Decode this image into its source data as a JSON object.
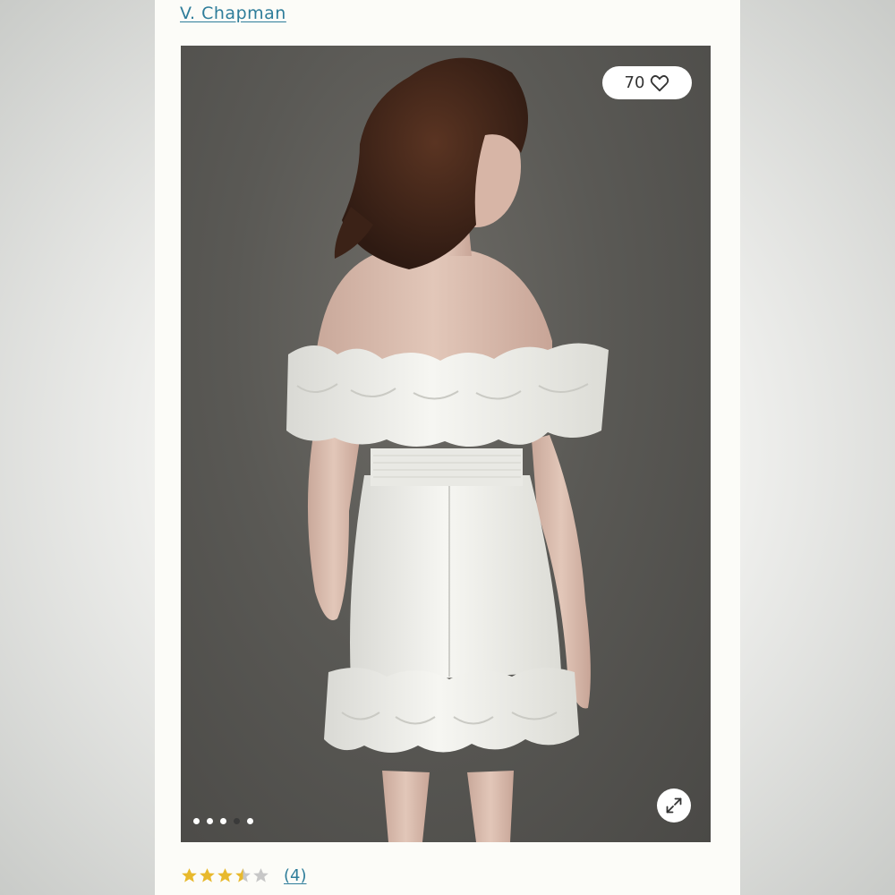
{
  "product": {
    "brand": "V. Chapman",
    "favorites_count": "70",
    "image_alt": "White off-the-shoulder ruffled mini dress, back view",
    "gallery": {
      "total": 5,
      "active_index": 3
    },
    "rating": {
      "stars": 3.5,
      "max": 5,
      "review_count": "(4)"
    }
  },
  "icons": {
    "favorite": "heart-icon",
    "expand": "expand-icon"
  },
  "colors": {
    "link": "#2e7d9a",
    "star_filled": "#e8b92c",
    "star_empty": "#c7c7c7",
    "backdrop": "#5a5955"
  }
}
